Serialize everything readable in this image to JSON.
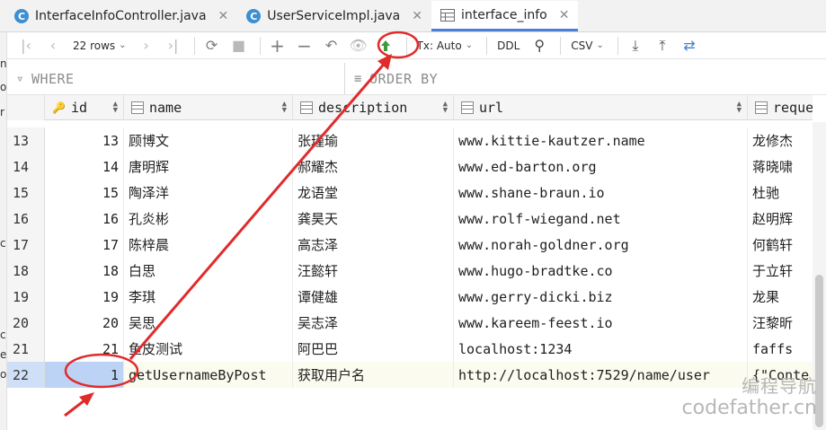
{
  "tabs": [
    {
      "label": "InterfaceInfoController.java",
      "icon": "class-c-icon",
      "active": false
    },
    {
      "label": "UserServiceImpl.java",
      "icon": "class-c-icon",
      "active": false
    },
    {
      "label": "interface_info",
      "icon": "table-icon",
      "active": true
    }
  ],
  "toolbar": {
    "rows_label": "22 rows",
    "tx_label": "Tx: Auto",
    "ddl_label": "DDL",
    "export_label": "CSV"
  },
  "filters": {
    "where_label": "WHERE",
    "order_label": "ORDER BY"
  },
  "columns": [
    "id",
    "name",
    "description",
    "url",
    "reque"
  ],
  "rows": [
    {
      "rownum": "13",
      "id": "13",
      "name": "顾博文",
      "description": "张瑾瑜",
      "url": "www.kittie-kautzer.name",
      "reque": "龙修杰"
    },
    {
      "rownum": "14",
      "id": "14",
      "name": "唐明辉",
      "description": "郝耀杰",
      "url": "www.ed-barton.org",
      "reque": "蒋晓啸"
    },
    {
      "rownum": "15",
      "id": "15",
      "name": "陶泽洋",
      "description": "龙语堂",
      "url": "www.shane-braun.io",
      "reque": "杜驰"
    },
    {
      "rownum": "16",
      "id": "16",
      "name": "孔炎彬",
      "description": "龚昊天",
      "url": "www.rolf-wiegand.net",
      "reque": "赵明辉"
    },
    {
      "rownum": "17",
      "id": "17",
      "name": "陈梓晨",
      "description": "高志泽",
      "url": "www.norah-goldner.org",
      "reque": "何鹤轩"
    },
    {
      "rownum": "18",
      "id": "18",
      "name": "白思",
      "description": "汪懿轩",
      "url": "www.hugo-bradtke.co",
      "reque": "于立轩"
    },
    {
      "rownum": "19",
      "id": "19",
      "name": "李琪",
      "description": "谭健雄",
      "url": "www.gerry-dicki.biz",
      "reque": "龙果"
    },
    {
      "rownum": "20",
      "id": "20",
      "name": "吴思",
      "description": "吴志泽",
      "url": "www.kareem-feest.io",
      "reque": "汪黎昕"
    },
    {
      "rownum": "21",
      "id": "21",
      "name": "鱼皮测试",
      "description": "阿巴巴",
      "url": "localhost:1234",
      "reque": "faffs"
    },
    {
      "rownum": "22",
      "id": "1",
      "name": "getUsernameByPost",
      "description": "获取用户名",
      "url": "http://localhost:7529/name/user",
      "reque": "{\"Conte"
    }
  ],
  "watermark": {
    "line1": "编程导航",
    "line2": "codefather.cn"
  },
  "colors": {
    "annotation": "#e02b2b",
    "tab_accent": "#4a7fd6",
    "submit_arrow": "#3a9d3a"
  }
}
